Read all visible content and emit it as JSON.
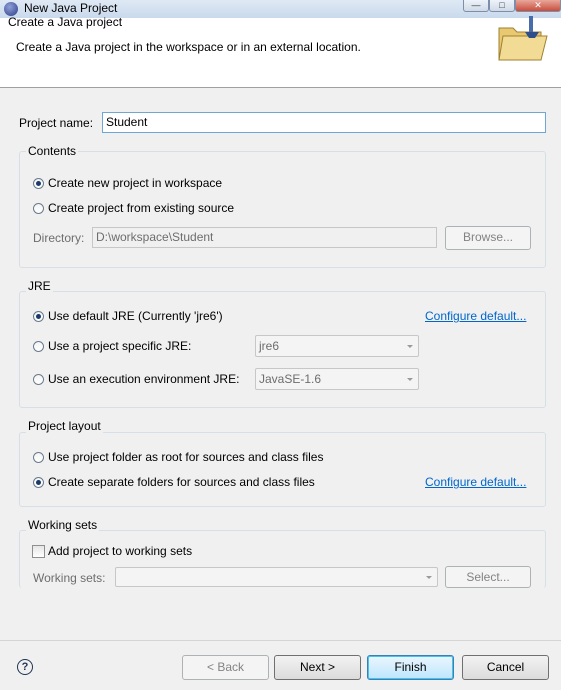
{
  "window": {
    "title": "New Java Project",
    "controls": [
      "minimize-icon",
      "maximize-icon",
      "close-icon"
    ]
  },
  "header": {
    "title": "Create a Java project",
    "description": "Create a Java project in the workspace or in an external location.",
    "icon": "java-project-folder-icon"
  },
  "project_name": {
    "label": "Project name:",
    "value": "Student"
  },
  "contents": {
    "group_label": "Contents",
    "options": [
      {
        "label": "Create new project in workspace",
        "selected": true
      },
      {
        "label": "Create project from existing source",
        "selected": false
      }
    ],
    "directory_label": "Directory:",
    "directory_value": "D:\\workspace\\Student",
    "browse_label": "Browse..."
  },
  "jre": {
    "group_label": "JRE",
    "options": [
      {
        "label": "Use default JRE (Currently 'jre6')",
        "selected": true
      },
      {
        "label": "Use a project specific JRE:",
        "selected": false
      },
      {
        "label": "Use an execution environment JRE:",
        "selected": false
      }
    ],
    "configure_link": "Configure default...",
    "specific_jre_value": "jre6",
    "execution_env_value": "JavaSE-1.6"
  },
  "project_layout": {
    "group_label": "Project layout",
    "options": [
      {
        "label": "Use project folder as root for sources and class files",
        "selected": false
      },
      {
        "label": "Create separate folders for sources and class files",
        "selected": true
      }
    ],
    "configure_link": "Configure default..."
  },
  "working_sets": {
    "group_label": "Working sets",
    "checkbox_label": "Add project to working sets",
    "checked": false,
    "sets_label": "Working sets:",
    "sets_value": "",
    "select_label": "Select..."
  },
  "footer": {
    "back_label": "< Back",
    "next_label": "Next >",
    "finish_label": "Finish",
    "cancel_label": "Cancel"
  },
  "colors": {
    "link": "#0066cc",
    "dialog_bg": "#f0f0f0",
    "header_bg": "#ffffff"
  }
}
